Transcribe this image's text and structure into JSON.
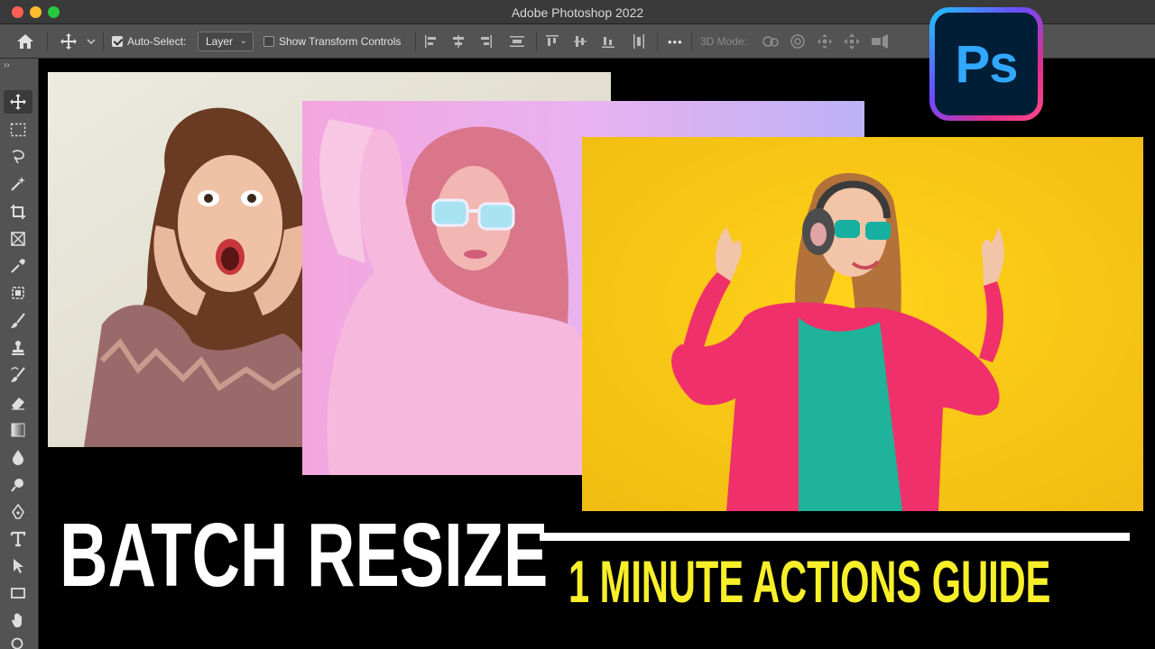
{
  "window": {
    "title": "Adobe Photoshop 2022"
  },
  "options_bar": {
    "auto_select_label": "Auto-Select:",
    "auto_select_checked": true,
    "layer_select_value": "Layer",
    "show_transform_label": "Show Transform Controls",
    "show_transform_checked": false,
    "mode_3d_label": "3D Mode:",
    "more_label": "•••"
  },
  "toolbox": {
    "grip": "››",
    "tools": [
      "move-tool-icon",
      "marquee-tool-icon",
      "lasso-tool-icon",
      "magic-wand-tool-icon",
      "crop-tool-icon",
      "frame-tool-icon",
      "eyedropper-tool-icon",
      "healing-brush-tool-icon",
      "brush-tool-icon",
      "clone-stamp-tool-icon",
      "history-brush-tool-icon",
      "eraser-tool-icon",
      "gradient-tool-icon",
      "blur-tool-icon",
      "dodge-tool-icon",
      "pen-tool-icon",
      "type-tool-icon",
      "path-selection-tool-icon",
      "rectangle-tool-icon",
      "hand-tool-icon",
      "zoom-tool-icon"
    ]
  },
  "overlay": {
    "headline": "BATCH RESIZE",
    "subheadline": "1 MINUTE ACTIONS GUIDE",
    "logo_text": "Ps"
  },
  "colors": {
    "subheadline": "#f7ef2a",
    "logo_accent": "#31a8ff",
    "logo_bg": "#001e36",
    "yellow_backdrop": "#f5c518",
    "pink_jacket": "#f0306a"
  }
}
